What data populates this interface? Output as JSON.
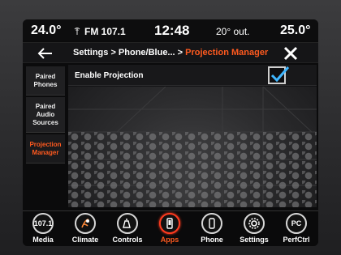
{
  "status_bar": {
    "temp_left": "24.0°",
    "radio": "FM 107.1",
    "clock": "12:48",
    "outside_temp": "20° out.",
    "temp_right": "25.0°"
  },
  "header": {
    "breadcrumb_path": "Settings > Phone/Blue... > ",
    "breadcrumb_active": "Projection Manager",
    "accent_color": "#ff5a1f"
  },
  "sidebar": {
    "items": [
      {
        "label": "Paired Phones",
        "active": false
      },
      {
        "label": "Paired Audio Sources",
        "active": false
      },
      {
        "label": "Projection Manager",
        "active": true
      }
    ]
  },
  "content": {
    "enable_projection_label": "Enable Projection",
    "enable_projection_checked": true
  },
  "dock": {
    "items": [
      {
        "label": "Media",
        "icon": "107.1"
      },
      {
        "label": "Climate",
        "icon": "climate-icon"
      },
      {
        "label": "Controls",
        "icon": "controls-icon"
      },
      {
        "label": "Apps",
        "icon": "apps-icon",
        "active": true
      },
      {
        "label": "Phone",
        "icon": "phone-icon"
      },
      {
        "label": "Settings",
        "icon": "gear-icon"
      },
      {
        "label": "PerfCtrl",
        "icon": "PC"
      }
    ]
  }
}
